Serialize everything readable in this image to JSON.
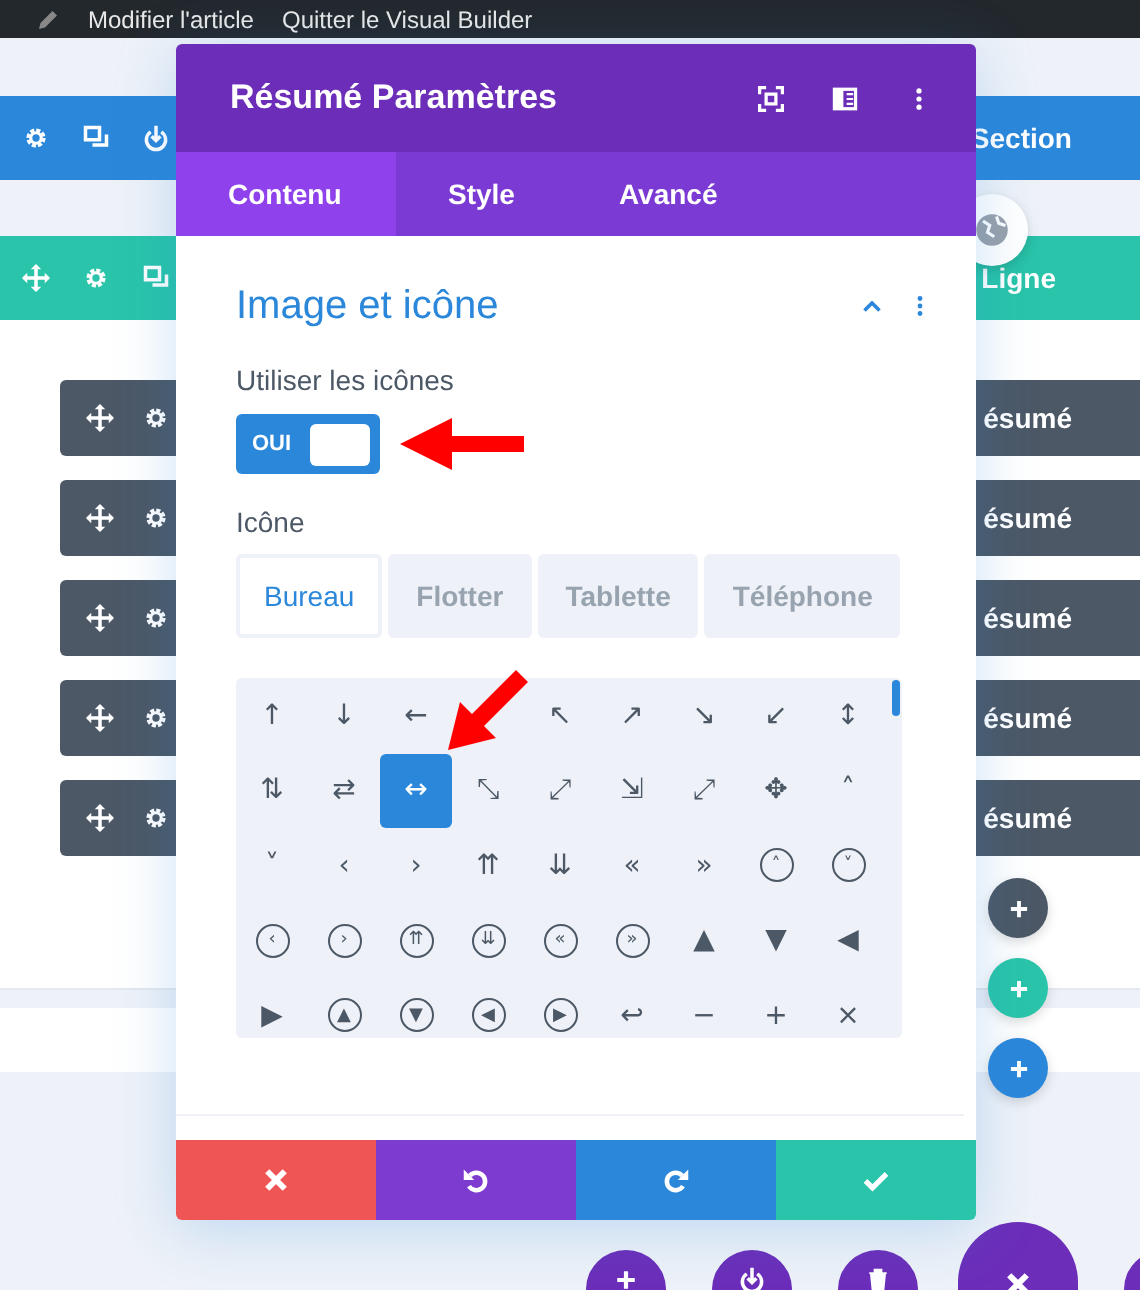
{
  "top_bar": {
    "links": [
      "Modifier l'article",
      "Quitter le Visual Builder"
    ]
  },
  "section_bar": {
    "label": "Section"
  },
  "row_bar": {
    "label": "Ligne"
  },
  "modules": [
    {
      "label": "ésumé"
    },
    {
      "label": "ésumé"
    },
    {
      "label": "ésumé"
    },
    {
      "label": "ésumé"
    },
    {
      "label": "ésumé"
    }
  ],
  "modal": {
    "title": "Résumé Paramètres",
    "tabs": [
      {
        "label": "Contenu",
        "selected": true
      },
      {
        "label": "Style",
        "selected": false
      },
      {
        "label": "Avancé",
        "selected": false
      }
    ],
    "group": {
      "title": "Image et icône",
      "expanded": true,
      "toggle": {
        "label": "Utiliser les icônes",
        "text": "OUI",
        "on": true
      },
      "icon_field": {
        "label": "Icône",
        "device_tabs": [
          {
            "label": "Bureau",
            "selected": true
          },
          {
            "label": "Flotter",
            "selected": false
          },
          {
            "label": "Tablette",
            "selected": false
          },
          {
            "label": "Téléphone",
            "selected": false
          }
        ],
        "icons": [
          {
            "glyph": "↑",
            "kind": "plain",
            "selected": false
          },
          {
            "glyph": "↓",
            "kind": "plain",
            "selected": false
          },
          {
            "glyph": "←",
            "kind": "plain",
            "selected": false
          },
          {
            "selected": false
          },
          {
            "glyph": "↖",
            "kind": "plain",
            "selected": false
          },
          {
            "glyph": "↗",
            "kind": "plain",
            "selected": false
          },
          {
            "glyph": "↘",
            "kind": "plain",
            "selected": false
          },
          {
            "glyph": "↙",
            "kind": "plain",
            "selected": false
          },
          {
            "glyph": "↕",
            "kind": "plain",
            "selected": false
          },
          {
            "glyph": "⇅",
            "kind": "plain",
            "selected": false
          },
          {
            "glyph": "⇄",
            "kind": "plain",
            "selected": false
          },
          {
            "glyph": "↔",
            "kind": "plain",
            "selected": true
          },
          {
            "glyph": "⤡",
            "kind": "plain",
            "selected": false
          },
          {
            "glyph": "⤢",
            "kind": "plain",
            "selected": false
          },
          {
            "glyph": "⇲",
            "kind": "plain",
            "selected": false
          },
          {
            "glyph": "⤢",
            "kind": "plain",
            "selected": false
          },
          {
            "glyph": "✥",
            "kind": "plain",
            "selected": false
          },
          {
            "glyph": "˄",
            "kind": "plain",
            "selected": false
          },
          {
            "glyph": "˅",
            "kind": "plain",
            "selected": false
          },
          {
            "glyph": "‹",
            "kind": "plain",
            "selected": false
          },
          {
            "glyph": "›",
            "kind": "plain",
            "selected": false
          },
          {
            "glyph": "⇈",
            "kind": "plain",
            "selected": false
          },
          {
            "glyph": "⇊",
            "kind": "plain",
            "selected": false
          },
          {
            "glyph": "«",
            "kind": "plain",
            "selected": false
          },
          {
            "glyph": "»",
            "kind": "plain",
            "selected": false
          },
          {
            "glyph": "˄",
            "kind": "circled",
            "selected": false
          },
          {
            "glyph": "˅",
            "kind": "circled",
            "selected": false
          },
          {
            "glyph": "‹",
            "kind": "circled",
            "selected": false
          },
          {
            "glyph": "›",
            "kind": "circled",
            "selected": false
          },
          {
            "glyph": "⇈",
            "kind": "circled",
            "selected": false
          },
          {
            "glyph": "⇊",
            "kind": "circled",
            "selected": false
          },
          {
            "glyph": "«",
            "kind": "circled",
            "selected": false
          },
          {
            "glyph": "»",
            "kind": "circled",
            "selected": false
          },
          {
            "glyph": "▲",
            "kind": "plain",
            "selected": false
          },
          {
            "glyph": "▼",
            "kind": "plain",
            "selected": false
          },
          {
            "glyph": "◀",
            "kind": "plain",
            "selected": false
          },
          {
            "glyph": "▶",
            "kind": "plain",
            "selected": false
          },
          {
            "glyph": "▲",
            "kind": "circled",
            "selected": false
          },
          {
            "glyph": "▼",
            "kind": "circled",
            "selected": false
          },
          {
            "glyph": "◀",
            "kind": "circled",
            "selected": false
          },
          {
            "glyph": "▶",
            "kind": "circled",
            "selected": false
          },
          {
            "glyph": "↩",
            "kind": "plain",
            "selected": false
          },
          {
            "glyph": "−",
            "kind": "plain",
            "selected": false
          },
          {
            "glyph": "+",
            "kind": "plain",
            "selected": false
          },
          {
            "glyph": "×",
            "kind": "plain",
            "selected": false
          }
        ]
      }
    }
  }
}
